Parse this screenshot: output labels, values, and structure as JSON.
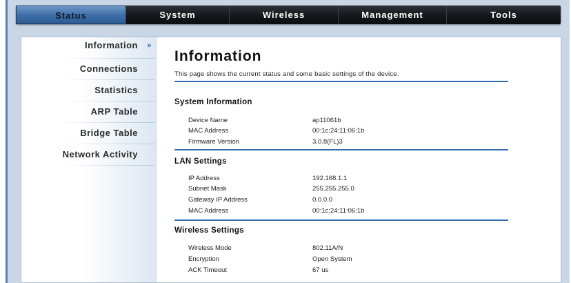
{
  "nav": {
    "tabs": [
      {
        "label": "Status"
      },
      {
        "label": "System"
      },
      {
        "label": "Wireless"
      },
      {
        "label": "Management"
      },
      {
        "label": "Tools"
      }
    ],
    "active": "Status"
  },
  "sidebar": {
    "items": [
      {
        "label": "Information",
        "marker": "»"
      },
      {
        "label": "Connections"
      },
      {
        "label": "Statistics"
      },
      {
        "label": "ARP Table"
      },
      {
        "label": "Bridge Table"
      },
      {
        "label": "Network Activity"
      }
    ]
  },
  "page": {
    "title": "Information",
    "description": "This page shows the current status and some basic settings of the device."
  },
  "system_info": {
    "title": "System Information",
    "rows": [
      {
        "label": "Device Name",
        "value": "ap11061b"
      },
      {
        "label": "MAC Address",
        "value": "00:1c:24:11:06:1b"
      },
      {
        "label": "Firmware Version",
        "value": "3.0.8(FL)3"
      }
    ]
  },
  "lan_settings": {
    "title": "LAN Settings",
    "rows": [
      {
        "label": "IP Address",
        "value": "192.168.1.1"
      },
      {
        "label": "Subnet Mask",
        "value": "255.255.255.0"
      },
      {
        "label": "Gateway IP Address",
        "value": "0.0.0.0"
      },
      {
        "label": "MAC Address",
        "value": "00:1c:24:11:06:1b"
      }
    ]
  },
  "wireless_settings": {
    "title": "Wireless Settings",
    "rows": [
      {
        "label": "Wireless Mode",
        "value": "802.11A/N"
      },
      {
        "label": "Encryption",
        "value": "Open System"
      },
      {
        "label": "ACK Timeout",
        "value": "67 us"
      }
    ]
  },
  "colors": {
    "accent": "#2f6cb0",
    "frame": "#c8d6e6",
    "nav_active": "#4a78b0"
  }
}
